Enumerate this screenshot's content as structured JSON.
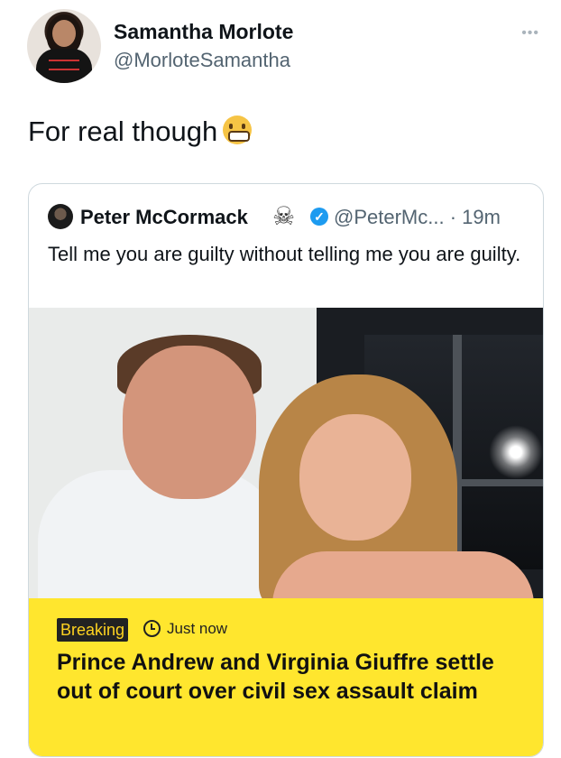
{
  "tweet": {
    "author_name": "Samantha Morlote",
    "author_handle": "@MorloteSamantha",
    "more_glyph": "•••",
    "text": "For real though",
    "emoji": "grimacing-face"
  },
  "quoted_tweet": {
    "author_name": "Peter McCormack",
    "name_emoji": "☠",
    "verified_glyph": "✓",
    "handle_time": "@PeterMc... · 19m",
    "text": "Tell me you are guilty without telling me you are guilty.",
    "media": {
      "badge": "Breaking",
      "time": "Just now",
      "headline": "Prince Andrew and Virginia Giuffre settle out of court over civil sex assault claim",
      "banner_color": "#ffe62e"
    }
  },
  "colors": {
    "text": "#0f1419",
    "secondary": "#536471",
    "verified": "#1d9bf0",
    "border": "#cfd9de"
  }
}
